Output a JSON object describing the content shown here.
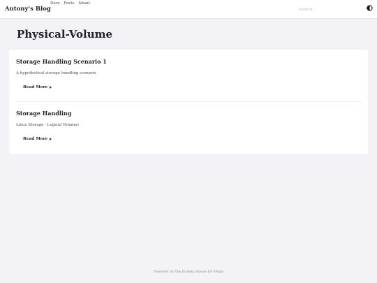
{
  "header": {
    "brand": "Antony's Blog",
    "nav": [
      {
        "label": "Docs"
      },
      {
        "label": "Posts"
      },
      {
        "label": "About"
      }
    ],
    "search": {
      "placeholder": "Search...",
      "value": ""
    },
    "theme_toggle_icon": "half-moon-contrast-icon"
  },
  "main": {
    "title": "Physical-Volume",
    "posts": [
      {
        "title": "Storage Handling Scenario 1",
        "summary": "A hypothetical storage handling scenario",
        "read_more": "Read More"
      },
      {
        "title": "Storage Handling",
        "summary": "Linux Storage - Logical Volumes",
        "read_more": "Read More"
      }
    ]
  },
  "footer": {
    "text": "Powered by the Eureka theme for Hugo"
  },
  "colors": {
    "background": "#f3f2f7",
    "surface": "#ffffff",
    "text": "#1f1f24"
  }
}
